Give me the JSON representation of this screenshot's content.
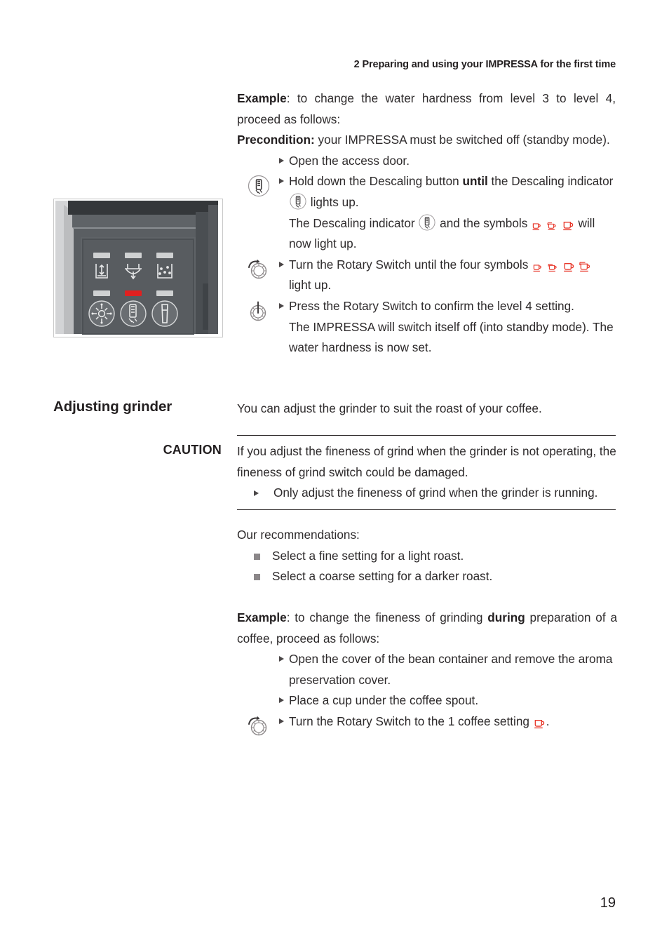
{
  "header": {
    "chapter_number": "2",
    "chapter_title": "Preparing and using your IMPRESSA for the first time"
  },
  "page_number": "19",
  "colors": {
    "text": "#2d2a2b",
    "heading": "#231f20",
    "symbol_red": "#e8392c",
    "panel_dark": "#565a5e",
    "panel_darker": "#3a3d40",
    "led_red": "#e02020",
    "led_grey": "#cfd1d2",
    "bullet_grey": "#8b8789"
  },
  "machine_image": {
    "alt": "IMPRESSA front panel with access door open showing indicator LEDs and buttons",
    "top_row_icons": [
      "water-tank-icon",
      "coffee-spout-icon",
      "grounds-container-icon"
    ],
    "bottom_row_buttons": [
      "cleaning-button",
      "descaling-button",
      "filter-button"
    ],
    "led_states": [
      "grey",
      "grey",
      "grey",
      "grey",
      "red",
      "grey"
    ]
  },
  "intro": {
    "example_label": "Example",
    "example_text": ": to change the water hardness from level 3 to level 4, proceed as follows:",
    "precondition_label": "Precondition:",
    "precondition_text": " your IMPRESSA must be switched off (standby mode)."
  },
  "steps": [
    {
      "id": "open-access-door",
      "gutter_icon": "",
      "text": "Open the access door."
    },
    {
      "id": "hold-descaling-button",
      "gutter_icon": "descaling-button-icon",
      "pre": "Hold down the Descaling button ",
      "bold": "until",
      "post_a": " the Descaling indicator ",
      "icon_a": "descaling-indicator-icon",
      "post_b": " lights up."
    },
    {
      "id": "descaling-indicator-lights",
      "continuation": true,
      "pre": "The Descaling indicator ",
      "icon_a": "descaling-indicator-icon",
      "mid": " and the symbols ",
      "symbols": [
        "cup-small",
        "cup-small-double",
        "cup-large"
      ],
      "post": " will now light up."
    },
    {
      "id": "turn-rotary-switch-four-symbols",
      "gutter_icon": "rotary-switch-turn-icon",
      "pre": "Turn the Rotary Switch until the four symbols ",
      "symbols": [
        "cup-small",
        "cup-small-double",
        "cup-large",
        "cup-large-double"
      ],
      "post": " light up."
    },
    {
      "id": "press-rotary-switch-confirm",
      "gutter_icon": "rotary-switch-press-icon",
      "text": "Press the Rotary Switch to confirm the level 4 setting."
    },
    {
      "id": "switch-off-result",
      "continuation": true,
      "text": "The IMPRESSA will switch itself off (into standby mode). The water hardness is now set."
    }
  ],
  "adjusting_grinder": {
    "heading": "Adjusting grinder",
    "intro": "You can adjust the grinder to suit the roast of your coffee.",
    "caution_label": "CAUTION",
    "caution_text": "If you adjust the fineness of grind when the grinder is not operating, the fineness of grind switch could be damaged.",
    "caution_bullet": "Only adjust the fineness of grind when the grinder is running.",
    "recommendations_label": "Our recommendations:",
    "recommendations": [
      "Select a fine setting for a light roast.",
      "Select a coarse setting for a darker roast."
    ],
    "example_label": "Example",
    "example_pre": ": to change the fineness of grinding ",
    "example_bold": "during",
    "example_post": " preparation of a coffee, proceed as follows:",
    "steps": [
      {
        "id": "open-bean-container-cover",
        "gutter_icon": "",
        "text": "Open the cover of the bean container and remove the aroma preservation cover."
      },
      {
        "id": "place-cup-under-spout",
        "gutter_icon": "",
        "text": "Place a cup under the coffee spout."
      },
      {
        "id": "turn-rotary-one-coffee",
        "gutter_icon": "rotary-switch-turn-icon",
        "pre": "Turn the Rotary Switch to the 1 coffee setting ",
        "symbols": [
          "cup-large"
        ],
        "post": "."
      }
    ]
  }
}
